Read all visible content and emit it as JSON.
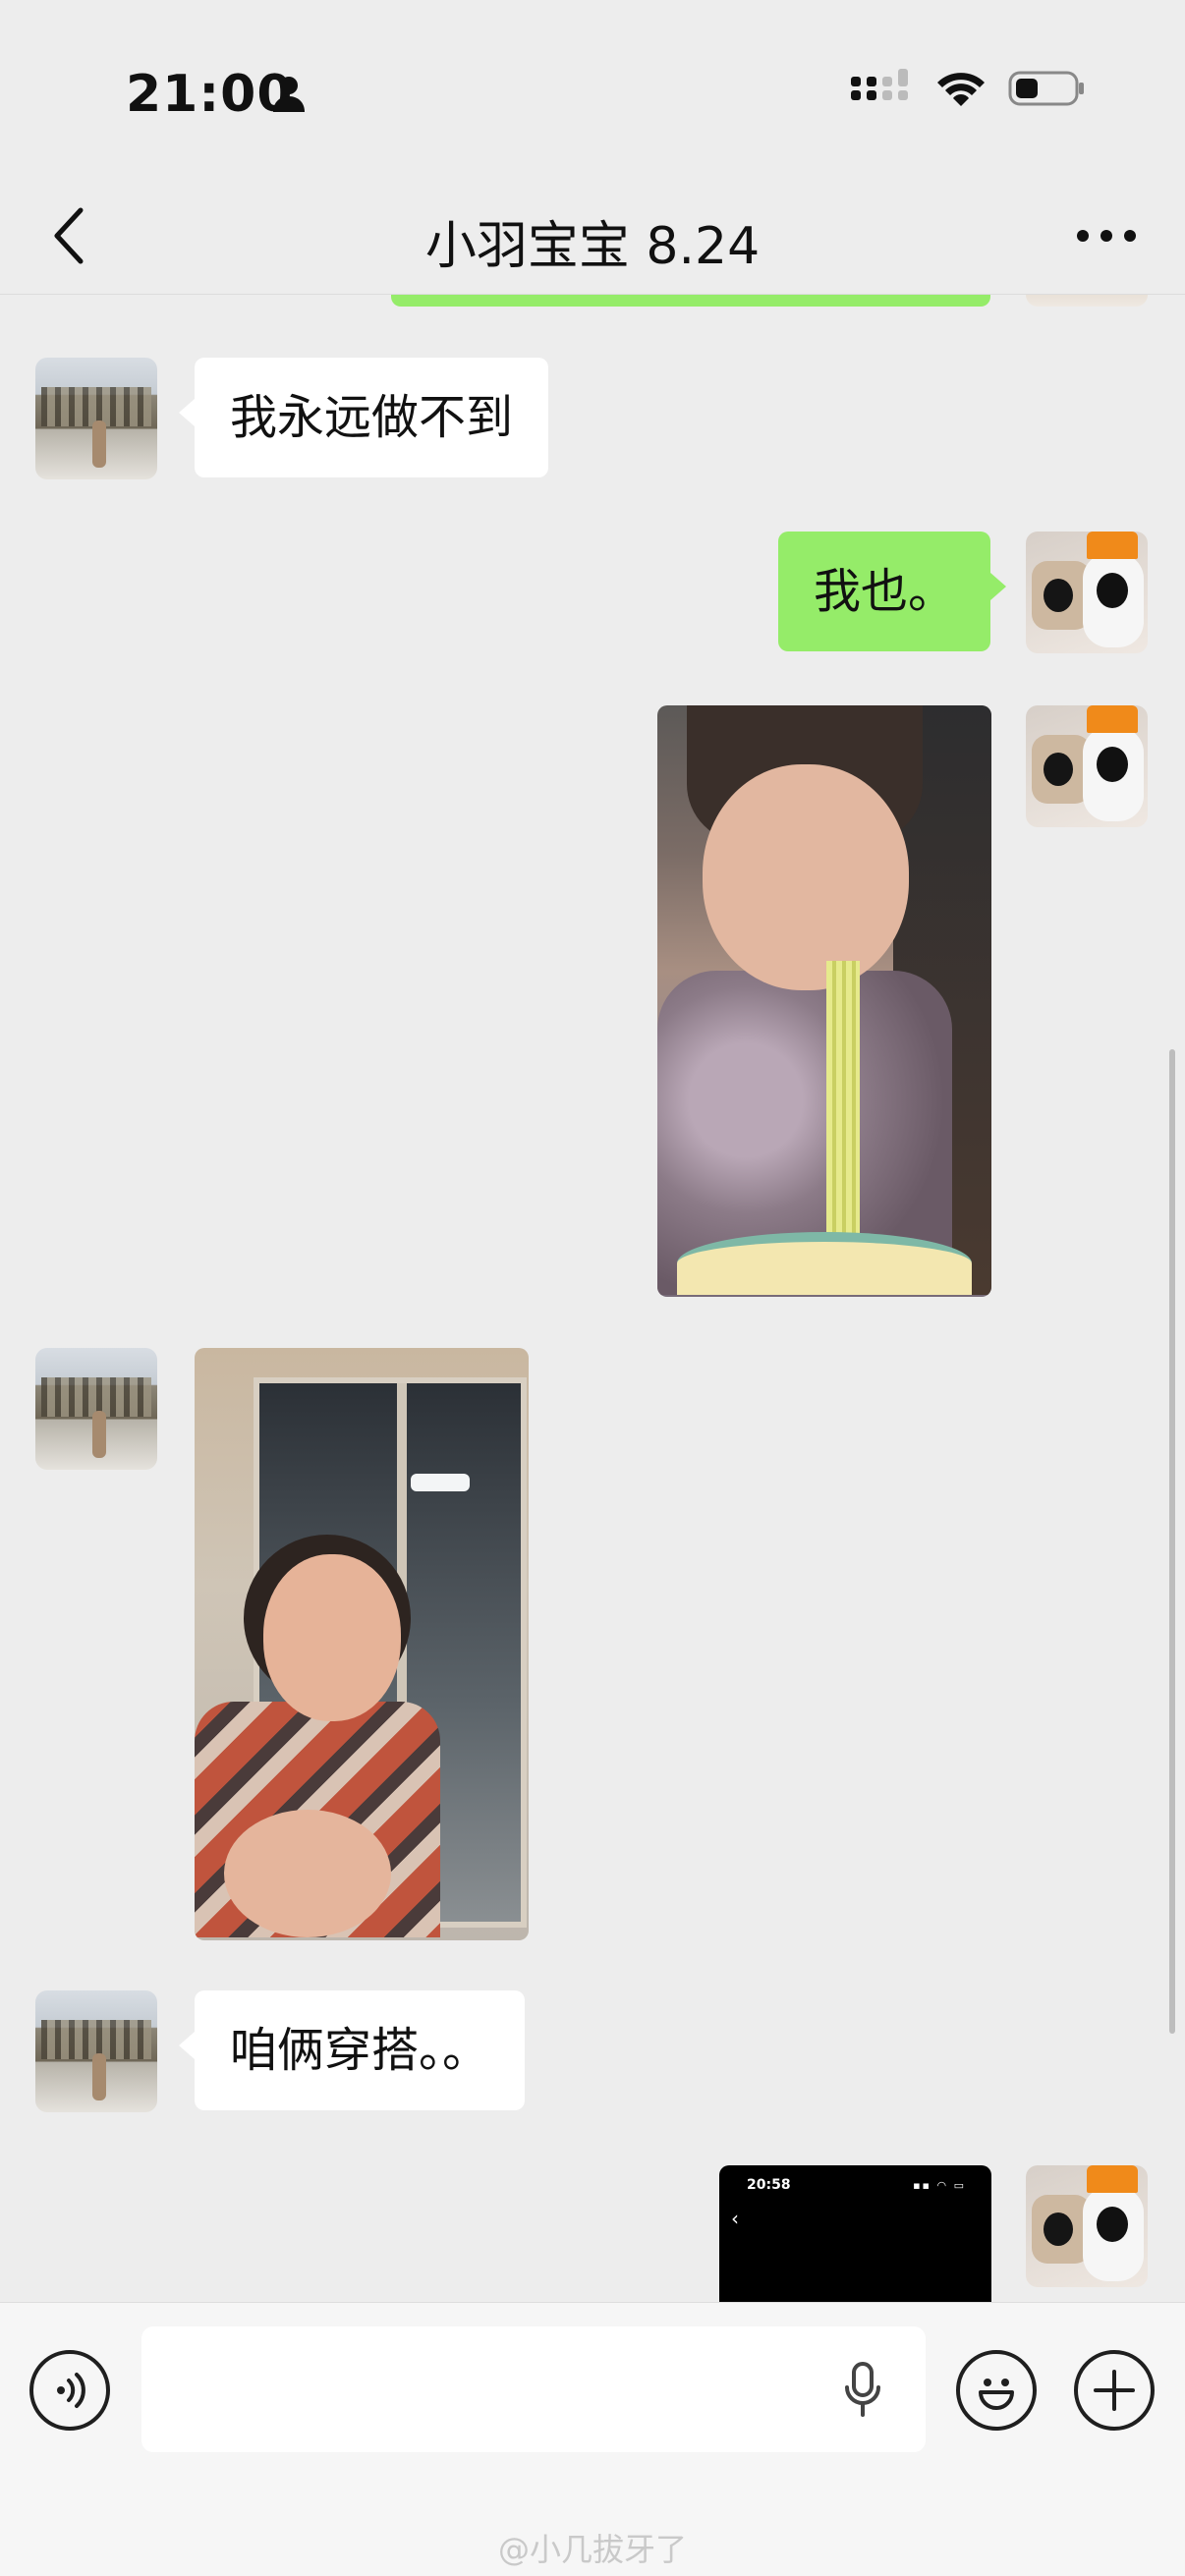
{
  "status_bar": {
    "time": "21:00",
    "icons": [
      "person-icon",
      "cellular-signal-icon",
      "wifi-icon",
      "battery-icon"
    ]
  },
  "nav": {
    "title": "小羽宝宝 8.24",
    "back_icon": "chevron-left-icon",
    "more_icon": "more-dots-icon"
  },
  "messages": [
    {
      "direction": "incoming",
      "type": "text",
      "text": "我永远做不到"
    },
    {
      "direction": "outgoing",
      "type": "text",
      "text": "我也。"
    },
    {
      "direction": "outgoing",
      "type": "image",
      "description": "selfie-eating-noodles"
    },
    {
      "direction": "incoming",
      "type": "image",
      "description": "selfie-by-window"
    },
    {
      "direction": "incoming",
      "type": "text",
      "text": "咱俩穿搭。。"
    },
    {
      "direction": "outgoing",
      "type": "image",
      "description": "phone-screenshot"
    }
  ],
  "embedded_screenshot": {
    "time": "20:58"
  },
  "input_bar": {
    "voice_icon": "voice-toggle-icon",
    "mic_icon": "microphone-icon",
    "emoji_icon": "emoji-icon",
    "plus_icon": "plus-icon",
    "text_value": ""
  },
  "watermark": "@小几拔牙了",
  "colors": {
    "background": "#ededed",
    "outgoing_bubble": "#95ec69",
    "incoming_bubble": "#ffffff",
    "input_bar": "#f6f6f6"
  }
}
